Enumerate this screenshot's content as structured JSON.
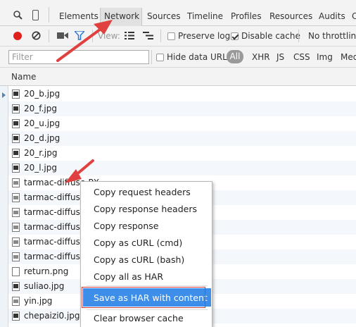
{
  "toolbar": {
    "tabs": [
      "Elements",
      "Network",
      "Sources",
      "Timeline",
      "Profiles",
      "Resources",
      "Audits",
      "C"
    ],
    "view_label": "View:",
    "preserve_log": "Preserve log",
    "disable_cache": "Disable cache",
    "throttling": "No throttling"
  },
  "filterbar": {
    "placeholder": "Filter",
    "hide_data_urls": "Hide data URLs",
    "types": [
      "All",
      "XHR",
      "JS",
      "CSS",
      "Img",
      "Med"
    ]
  },
  "table": {
    "header": "Name",
    "rows": [
      {
        "name": "20_b.jpg",
        "icon": "dark"
      },
      {
        "name": "20_f.jpg",
        "icon": "dark"
      },
      {
        "name": "20_u.jpg",
        "icon": "dark"
      },
      {
        "name": "20_d.jpg",
        "icon": "dark"
      },
      {
        "name": "20_r.jpg",
        "icon": "dark"
      },
      {
        "name": "20_l.jpg",
        "icon": "dark"
      },
      {
        "name": "tarmac-diffuse-PX...",
        "icon": "img"
      },
      {
        "name": "tarmac-diffuse-",
        "icon": "img"
      },
      {
        "name": "tarmac-diffuse-",
        "icon": "img"
      },
      {
        "name": "tarmac-diffuse-",
        "icon": "img"
      },
      {
        "name": "tarmac-diffuse-",
        "icon": "img"
      },
      {
        "name": "tarmac-diffuse-",
        "icon": "img"
      },
      {
        "name": "return.png",
        "icon": "plain"
      },
      {
        "name": "suliao.jpg",
        "icon": "dark"
      },
      {
        "name": "yin.jpg",
        "icon": "img"
      },
      {
        "name": "chepaizi0.jpg",
        "icon": "dark"
      }
    ]
  },
  "context_menu": {
    "items": [
      "Copy request headers",
      "Copy response headers",
      "Copy response",
      "Copy as cURL (cmd)",
      "Copy as cURL (bash)",
      "Copy all as HAR",
      "Save as HAR with content",
      "Clear browser cache"
    ],
    "highlighted_index": 6
  },
  "colors": {
    "highlight": "#3d8ee8",
    "annotation_red": "#e04040",
    "record": "#e0201c"
  }
}
